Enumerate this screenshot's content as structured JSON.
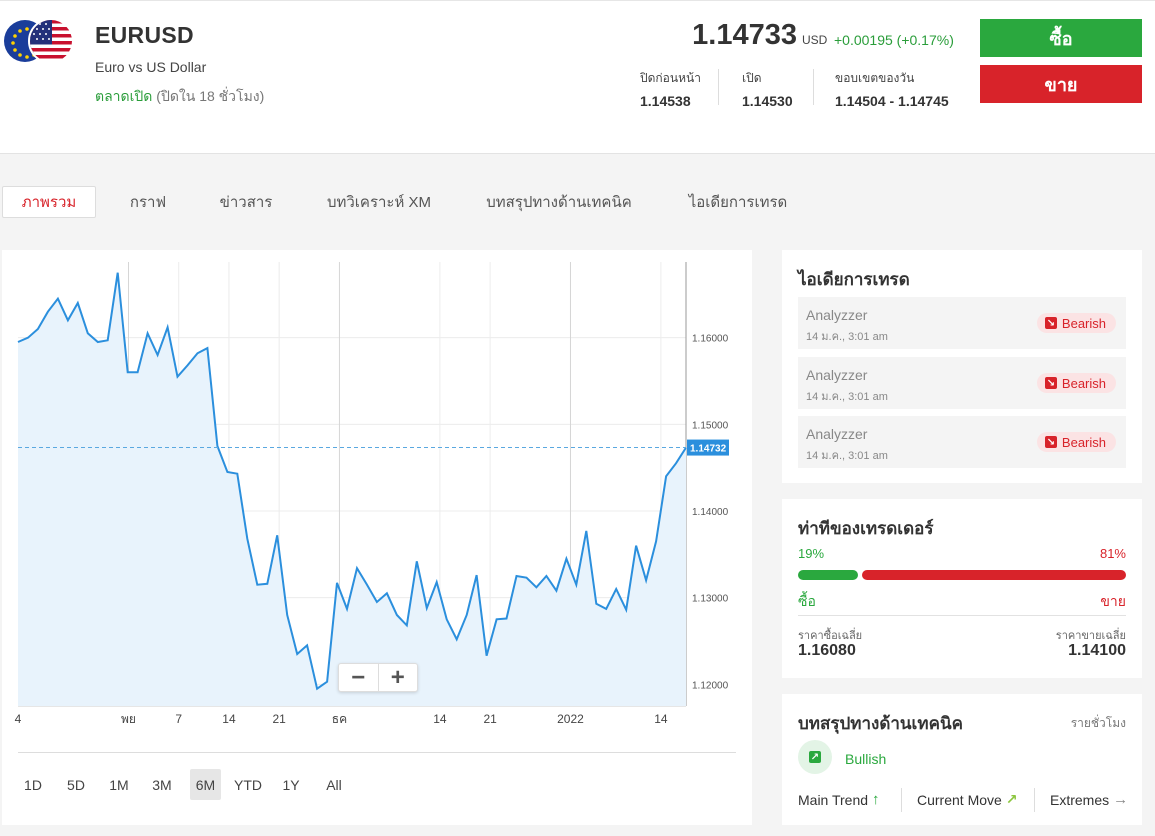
{
  "header": {
    "symbol": "EURUSD",
    "description": "Euro vs US Dollar",
    "market_open": "ตลาดเปิด",
    "market_close_info": "(ปิดใน 18 ชั่วโมง)",
    "price": "1.14733",
    "currency": "USD",
    "change": "+0.00195 (+0.17%)",
    "stats": [
      {
        "label": "ปิดก่อนหน้า",
        "value": "1.14538"
      },
      {
        "label": "เปิด",
        "value": "1.14530"
      },
      {
        "label": "ขอบเขตของวัน",
        "value": "1.14504 - 1.14745"
      }
    ],
    "buy_label": "ซื้อ",
    "sell_label": "ขาย"
  },
  "tabs": [
    {
      "label": "ภาพรวม",
      "active": true
    },
    {
      "label": "กราฟ"
    },
    {
      "label": "ข่าวสาร"
    },
    {
      "label": "บทวิเคราะห์ XM"
    },
    {
      "label": "บทสรุปทางด้านเทคนิค"
    },
    {
      "label": "ไอเดียการเทรด"
    }
  ],
  "chart_data": {
    "type": "area",
    "x_tick_labels": [
      "4",
      "พย",
      "7",
      "14",
      "21",
      "ธค",
      "14",
      "21",
      "2022",
      "14"
    ],
    "y_tick_labels": [
      "1.16000",
      "1.15000",
      "1.14000",
      "1.13000",
      "1.12000"
    ],
    "ylim": [
      1.1175,
      1.1685
    ],
    "current_value_label": "1.14732",
    "current_value": 1.14732,
    "series": [
      {
        "values": [
          1.1595,
          1.16,
          1.161,
          1.163,
          1.1645,
          1.162,
          1.164,
          1.1605,
          1.1595,
          1.1597,
          1.1675,
          1.156,
          1.156,
          1.1605,
          1.158,
          1.1612,
          1.1555,
          1.1568,
          1.1582,
          1.1588,
          1.1475,
          1.1445,
          1.1443,
          1.1368,
          1.1315,
          1.1316,
          1.1372,
          1.128,
          1.1235,
          1.1245,
          1.1195,
          1.1203,
          1.1317,
          1.1287,
          1.1334,
          1.1315,
          1.1295,
          1.1305,
          1.128,
          1.1268,
          1.1342,
          1.1288,
          1.1318,
          1.1275,
          1.1252,
          1.128,
          1.1326,
          1.1233,
          1.1275,
          1.1276,
          1.1325,
          1.1323,
          1.1312,
          1.1325,
          1.1308,
          1.1345,
          1.1315,
          1.1377,
          1.1293,
          1.1287,
          1.131,
          1.1286,
          1.136,
          1.132,
          1.1365,
          1.144,
          1.1455,
          1.14732
        ]
      }
    ]
  },
  "zoom": {
    "minus": "−",
    "plus": "+"
  },
  "ranges": [
    {
      "label": "1D"
    },
    {
      "label": "5D"
    },
    {
      "label": "1M"
    },
    {
      "label": "3M"
    },
    {
      "label": "6M",
      "active": true
    },
    {
      "label": "YTD"
    },
    {
      "label": "1Y"
    },
    {
      "label": "All"
    }
  ],
  "trade_ideas": {
    "title": "ไอเดียการเทรด",
    "items": [
      {
        "name": "Analyzzer",
        "time": "14 ม.ค., 3:01 am",
        "signal": "Bearish"
      },
      {
        "name": "Analyzzer",
        "time": "14 ม.ค., 3:01 am",
        "signal": "Bearish"
      },
      {
        "name": "Analyzzer",
        "time": "14 ม.ค., 3:01 am",
        "signal": "Bearish"
      }
    ]
  },
  "sentiment": {
    "title": "ท่าทีของเทรดเดอร์",
    "buy_pct": "19%",
    "sell_pct": "81%",
    "buy_fraction": 0.19,
    "buy_label": "ซื้อ",
    "sell_label": "ขาย",
    "avg_buy_label": "ราคาซื้อเฉลี่ย",
    "avg_buy": "1.16080",
    "avg_sell_label": "ราคาขายเฉลี่ย",
    "avg_sell": "1.14100"
  },
  "technical": {
    "title": "บทสรุปทางด้านเทคนิค",
    "period": "รายชั่วโมง",
    "summary": "Bullish",
    "main_trend": "Main Trend",
    "current_move": "Current Move",
    "extremes": "Extremes"
  },
  "colors": {
    "buy": "#2aa83e",
    "sell": "#d8232a",
    "line": "#2b8fdd",
    "area": "#e8f3fc"
  }
}
